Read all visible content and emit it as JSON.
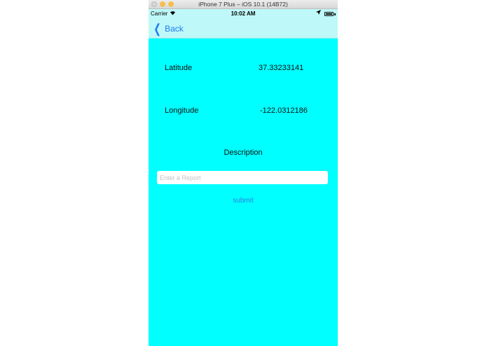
{
  "window": {
    "title": "iPhone 7 Plus – iOS 10.1 (14B72)"
  },
  "status_bar": {
    "carrier": "Carrier",
    "time": "10:02 AM",
    "wifi_icon": "wifi-icon",
    "location_icon": "location-arrow-icon",
    "battery_icon": "battery-icon"
  },
  "nav": {
    "back_label": "Back",
    "back_icon": "chevron-left-icon"
  },
  "location": {
    "latitude_label": "Latitude",
    "latitude_value": "37.33233141",
    "longitude_label": "Longitude",
    "longitude_value": "-122.0312186"
  },
  "report": {
    "description_label": "Description",
    "placeholder": "Enter a Report",
    "value": "",
    "submit_label": "submit"
  },
  "colors": {
    "background": "#00ffff",
    "bars": "#bff8f8",
    "accent": "#1a7cf5"
  }
}
